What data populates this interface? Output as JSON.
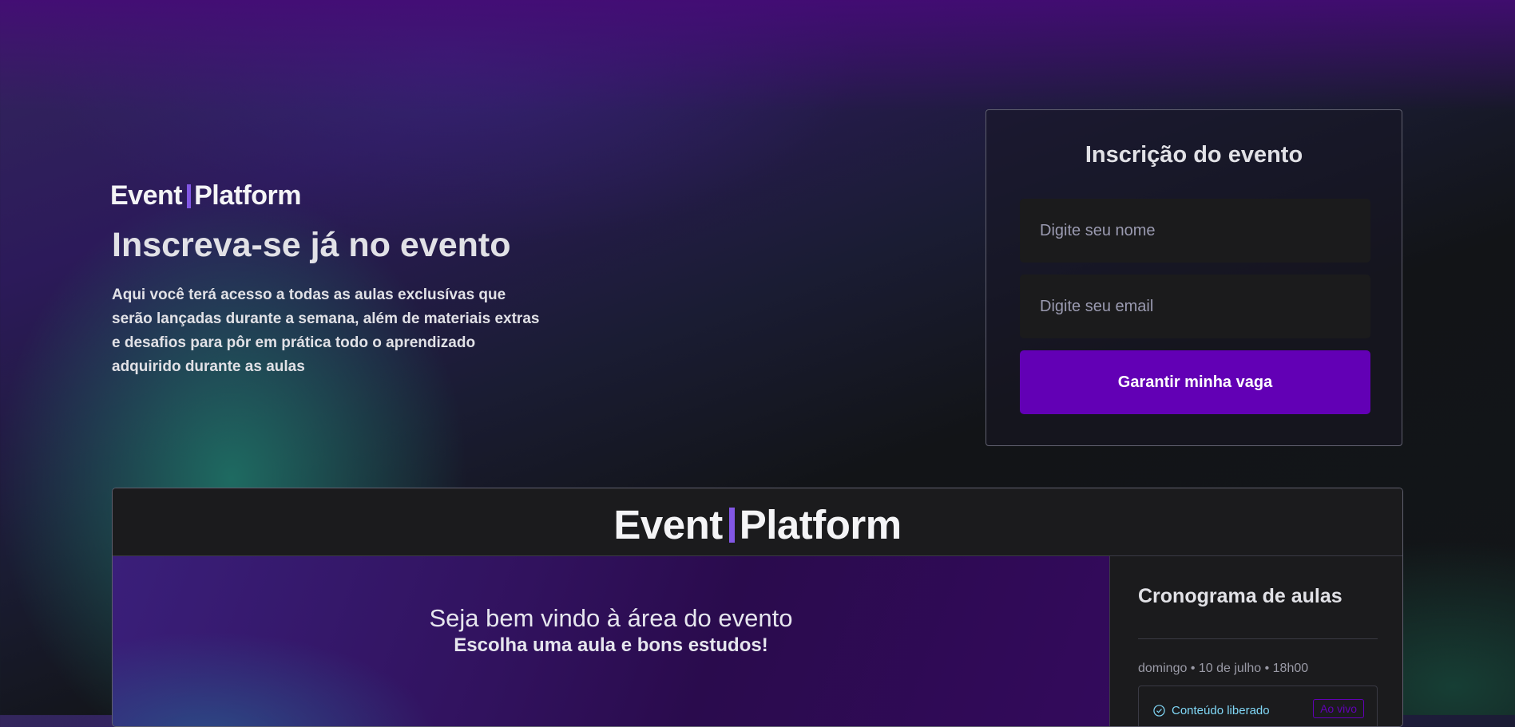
{
  "hero": {
    "logo_left": "Event",
    "logo_right": "Platform",
    "title": "Inscreva-se já no evento",
    "description": "Aqui você terá acesso a todas as aulas exclusívas que serão lançadas durante a semana, além de materiais extras e desafios para pôr em prática todo o aprendizado adquirido durante as aulas"
  },
  "form": {
    "title": "Inscrição do evento",
    "name_placeholder": "Digite seu nome",
    "email_placeholder": "Digite seu email",
    "submit_label": "Garantir minha vaga"
  },
  "preview": {
    "logo_left": "Event",
    "logo_right": "Platform",
    "welcome_title": "Seja bem vindo à área do evento",
    "welcome_subtitle": "Escolha uma aula e bons estudos!",
    "sidebar": {
      "title": "Cronograma de aulas",
      "lesson_date": "domingo • 10 de julho • 18h00",
      "lesson_status": "Conteúdo liberado",
      "lesson_badge": "Ao vivo",
      "status_icon": "check-circle-icon"
    }
  },
  "colors": {
    "accent": "#8257e5",
    "button": "#6200b5",
    "status": "#81d8f7"
  }
}
